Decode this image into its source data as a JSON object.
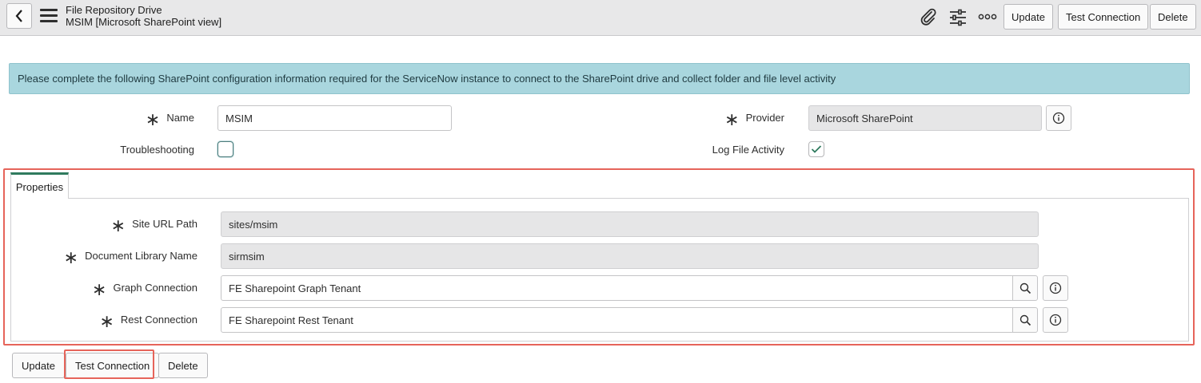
{
  "header": {
    "title": "File Repository Drive",
    "subtitle": "MSIM [Microsoft SharePoint view]",
    "buttons": {
      "update": "Update",
      "test_connection": "Test Connection",
      "delete": "Delete"
    }
  },
  "banner": {
    "text": "Please complete the following SharePoint configuration information required for the ServiceNow instance to connect to the SharePoint drive and collect folder and file level activity"
  },
  "form": {
    "name": {
      "label": "Name",
      "value": "MSIM",
      "required": true
    },
    "troubleshooting": {
      "label": "Troubleshooting",
      "checked": false
    },
    "provider": {
      "label": "Provider",
      "value": "Microsoft SharePoint",
      "required": true
    },
    "log_file_activity": {
      "label": "Log File Activity",
      "checked": true
    }
  },
  "properties": {
    "tab_label": "Properties",
    "site_url_path": {
      "label": "Site URL Path",
      "value": "sites/msim",
      "required": true
    },
    "document_library_name": {
      "label": "Document Library Name",
      "value": "sirmsim",
      "required": true
    },
    "graph_connection": {
      "label": "Graph Connection",
      "value": "FE Sharepoint Graph Tenant",
      "required": true
    },
    "rest_connection": {
      "label": "Rest Connection",
      "value": "FE Sharepoint Rest Tenant",
      "required": true
    }
  },
  "footer": {
    "buttons": {
      "update": "Update",
      "test_connection": "Test Connection",
      "delete": "Delete"
    }
  },
  "colors": {
    "banner_bg": "#a9d6de",
    "highlight": "#e6645a",
    "tab_accent": "#2f7a5e"
  }
}
